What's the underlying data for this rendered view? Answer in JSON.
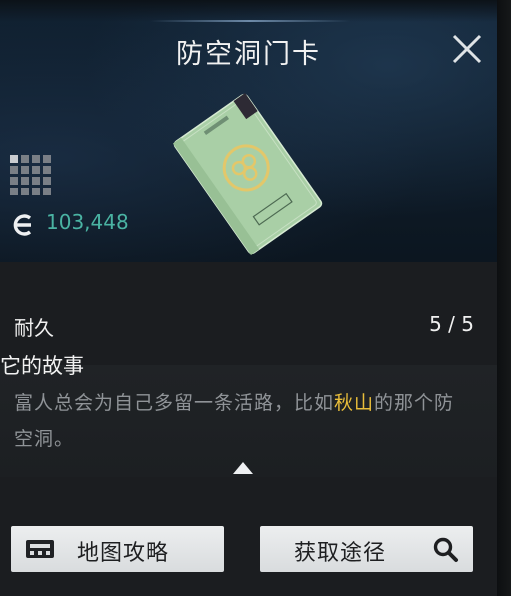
{
  "window": {
    "title": "防空洞门卡"
  },
  "item": {
    "image": "green-access-card",
    "price": {
      "icon": "currency-icon",
      "value": "103,448"
    },
    "stats": [
      {
        "label": "耐久",
        "value": "5 / 5"
      }
    ]
  },
  "story": {
    "heading": "它的故事",
    "text_before": "富人总会为自己多留一条活路，比如",
    "highlight": "秋山",
    "text_after": "的那个防空洞。",
    "highlight_color": "#e9be3a"
  },
  "buttons": {
    "map_guide": {
      "label": "地图攻略",
      "icon": "map-guide-icon"
    },
    "acquire": {
      "label": "获取途径",
      "icon": "search-icon"
    }
  },
  "colors": {
    "currency": "#4ab3a3",
    "accent_text": "#e9be3a"
  }
}
